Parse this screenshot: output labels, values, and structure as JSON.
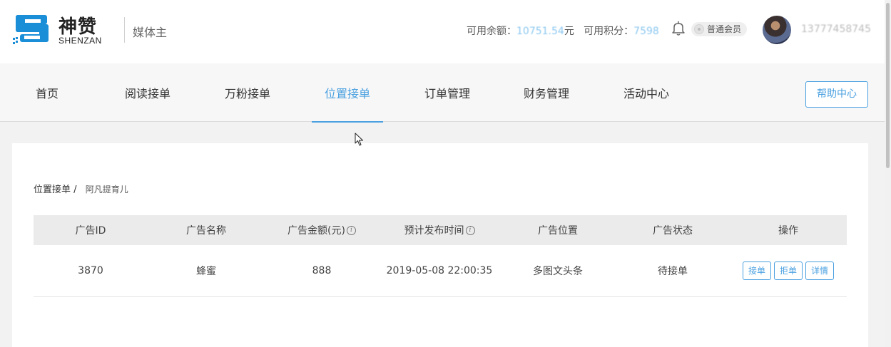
{
  "brand": {
    "name_cn": "神赞",
    "name_en": "SHENZAN",
    "role": "媒体主",
    "logo_color": "#1a8fd8"
  },
  "account": {
    "balance_label": "可用余额：",
    "balance_value": "10751.54",
    "balance_unit": "元",
    "points_label": "可用积分：",
    "points_value": "7598",
    "member_level": "普通会员",
    "phone": "13777458745"
  },
  "nav": {
    "items": [
      {
        "label": "首页"
      },
      {
        "label": "阅读接单"
      },
      {
        "label": "万粉接单"
      },
      {
        "label": "位置接单"
      },
      {
        "label": "订单管理"
      },
      {
        "label": "财务管理"
      },
      {
        "label": "活动中心"
      }
    ],
    "active_index": 3,
    "help_label": "帮助中心",
    "accent_color": "#4aa0e0"
  },
  "breadcrumb": {
    "parent": "位置接单",
    "separator": "/",
    "current": "阿凡提育儿"
  },
  "table": {
    "columns": [
      "广告ID",
      "广告名称",
      "广告金额(元)",
      "预计发布时间",
      "广告位置",
      "广告状态",
      "操作"
    ],
    "info_icon": "info-icon",
    "rows": [
      {
        "id": "3870",
        "name": "蜂蜜",
        "amount": "888",
        "publish_time": "2019-05-08 22:00:35",
        "position": "多图文头条",
        "status": "待接单",
        "actions": [
          "接单",
          "拒单",
          "详情"
        ]
      }
    ]
  }
}
